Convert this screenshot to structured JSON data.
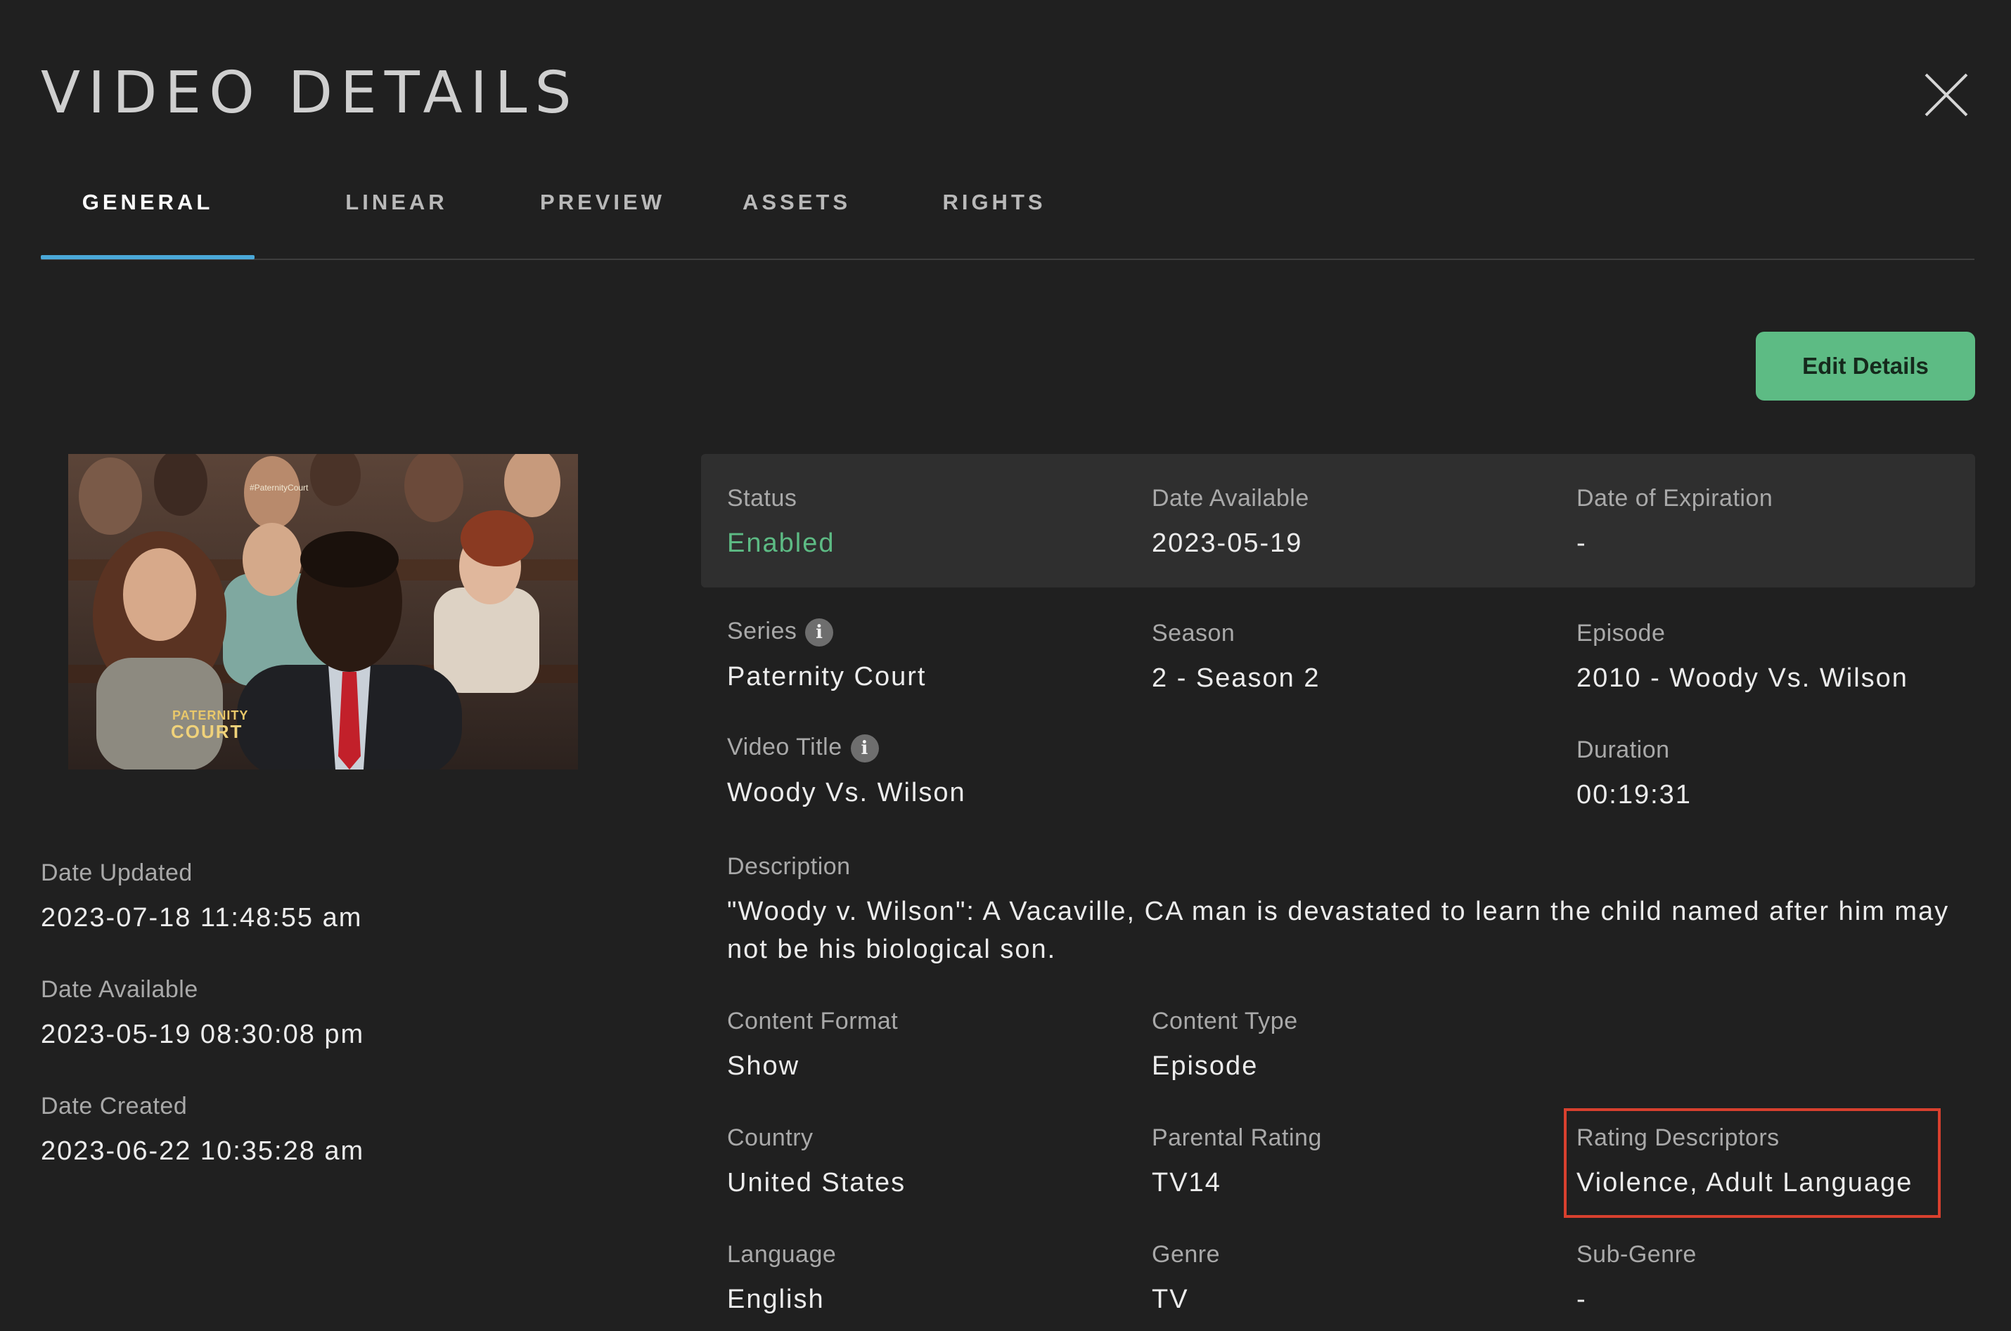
{
  "header": {
    "title": "VIDEO DETAILS",
    "close_icon": "close-icon"
  },
  "tabs": [
    {
      "label": "GENERAL",
      "active": true
    },
    {
      "label": "LINEAR",
      "active": false
    },
    {
      "label": "PREVIEW",
      "active": false
    },
    {
      "label": "ASSETS",
      "active": false
    },
    {
      "label": "RIGHTS",
      "active": false
    }
  ],
  "actions": {
    "edit_label": "Edit Details"
  },
  "thumbnail": {
    "hashtag": "#PaternityCourt",
    "logo_line1": "PATERNITY",
    "logo_line2": "COURT"
  },
  "left_meta": {
    "date_updated_label": "Date Updated",
    "date_updated_value": "2023-07-18 11:48:55 am",
    "date_available_label": "Date Available",
    "date_available_value": "2023-05-19 08:30:08 pm",
    "date_created_label": "Date Created",
    "date_created_value": "2023-06-22 10:35:28 am"
  },
  "status_panel": {
    "status_label": "Status",
    "status_value": "Enabled",
    "date_available_label": "Date Available",
    "date_available_value": "2023-05-19",
    "expiration_label": "Date of Expiration",
    "expiration_value": "-"
  },
  "details": {
    "series_label": "Series",
    "series_value": "Paternity Court",
    "season_label": "Season",
    "season_value": "2 - Season 2",
    "episode_label": "Episode",
    "episode_value": "2010 - Woody Vs. Wilson",
    "video_title_label": "Video Title",
    "video_title_value": "Woody Vs. Wilson",
    "duration_label": "Duration",
    "duration_value": "00:19:31",
    "description_label": "Description",
    "description_value": "\"Woody v. Wilson\": A Vacaville, CA man is devastated to learn the child named after him may not be his biological son.",
    "content_format_label": "Content Format",
    "content_format_value": "Show",
    "content_type_label": "Content Type",
    "content_type_value": "Episode",
    "country_label": "Country",
    "country_value": "United States",
    "parental_rating_label": "Parental Rating",
    "parental_rating_value": "TV14",
    "rating_descriptors_label": "Rating Descriptors",
    "rating_descriptors_value": "Violence, Adult Language",
    "language_label": "Language",
    "language_value": "English",
    "genre_label": "Genre",
    "genre_value": "TV",
    "subgenre_label": "Sub-Genre",
    "subgenre_value": "-"
  },
  "colors": {
    "background": "#202020",
    "accent_tab": "#4aa8d8",
    "button_green": "#5dbb84",
    "status_enabled": "#5dbb84",
    "highlight": "#d8402e"
  }
}
